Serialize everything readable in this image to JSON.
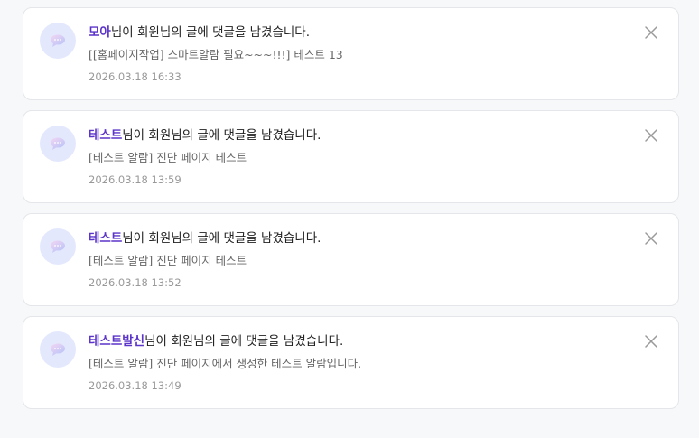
{
  "notifications": [
    {
      "sender": "모아",
      "action_text": "님이 회원님의 글에 댓글을 남겼습니다.",
      "message": "[[홈페이지작업] 스마트알람 필요~~~!!!] 테스트 13",
      "timestamp": "2026.03.18 16:33",
      "avatar_icon": "speech-bubble-icon",
      "close_icon": "close-icon"
    },
    {
      "sender": "테스트",
      "action_text": "님이 회원님의 글에 댓글을 남겼습니다.",
      "message": "[테스트 알람] 진단 페이지 테스트",
      "timestamp": "2026.03.18 13:59",
      "avatar_icon": "speech-bubble-icon",
      "close_icon": "close-icon"
    },
    {
      "sender": "테스트",
      "action_text": "님이 회원님의 글에 댓글을 남겼습니다.",
      "message": "[테스트 알람] 진단 페이지 테스트",
      "timestamp": "2026.03.18 13:52",
      "avatar_icon": "speech-bubble-icon",
      "close_icon": "close-icon"
    },
    {
      "sender": "테스트발신",
      "action_text": "님이 회원님의 글에 댓글을 남겼습니다.",
      "message": "[테스트 알람] 진단 페이지에서 생성한 테스트 알람입니다.",
      "timestamp": "2026.03.18 13:49",
      "avatar_icon": "speech-bubble-icon",
      "close_icon": "close-icon"
    }
  ],
  "colors": {
    "sender_accent": "#5b34c9",
    "avatar_background": "#e3e8fd",
    "page_background": "#f7f8f9"
  }
}
